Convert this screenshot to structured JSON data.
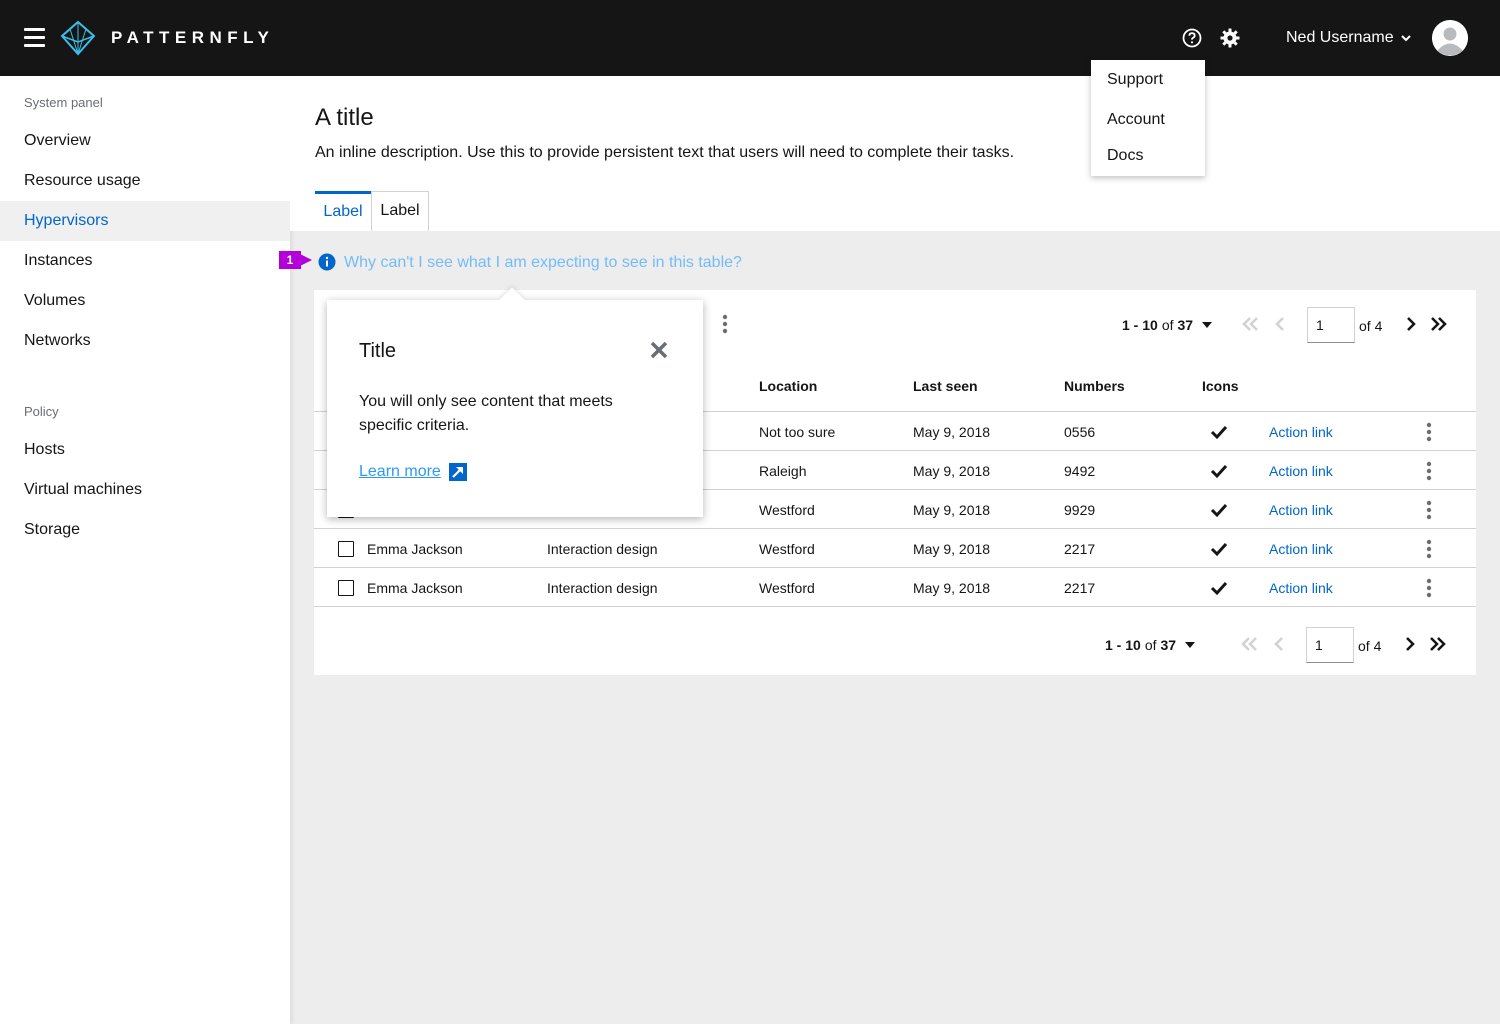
{
  "header": {
    "brand": "PATTERNFLY",
    "user_name": "Ned Username",
    "icons": [
      "hamburger-icon",
      "patternfly-logo-icon",
      "help-icon",
      "gear-icon",
      "chevron-down-icon",
      "avatar-icon"
    ]
  },
  "user_dropdown": {
    "items": [
      "Support",
      "Account",
      "Docs"
    ]
  },
  "sidebar": {
    "section_system": "System panel",
    "system_items": [
      "Overview",
      "Resource usage",
      "Hypervisors",
      "Instances",
      "Volumes",
      "Networks"
    ],
    "active_item": "Hypervisors",
    "section_policy": "Policy",
    "policy_items": [
      "Hosts",
      "Virtual machines",
      "Storage"
    ]
  },
  "page": {
    "title": "A title",
    "description": "An inline description. Use this to provide persistent text that users will need to complete their tasks.",
    "tabs": [
      "Label",
      "Label"
    ],
    "marker": "1",
    "help_link": "Why can't I see what I am expecting to see in this table?"
  },
  "popover": {
    "title": "Title",
    "body": "You will only see content that meets specific criteria.",
    "link": "Learn more"
  },
  "pagination": {
    "range_bold": "1 - 10",
    "of_text": "of",
    "total": "37",
    "page": "1",
    "of_pages": "of 4"
  },
  "table": {
    "columns": [
      "Location",
      "Last seen",
      "Numbers",
      "Icons"
    ],
    "rows": [
      {
        "name": "",
        "dept": "",
        "location": "Not too sure",
        "last_seen": "May 9, 2018",
        "number": "0556",
        "action": "Action link"
      },
      {
        "name": "",
        "dept": "",
        "location": "Raleigh",
        "last_seen": "May 9, 2018",
        "number": "9492",
        "action": "Action link"
      },
      {
        "name": "",
        "dept": "",
        "location": "Westford",
        "last_seen": "May 9, 2018",
        "number": "9929",
        "action": "Action link"
      },
      {
        "name": "Emma Jackson",
        "dept": "Interaction design",
        "location": "Westford",
        "last_seen": "May 9, 2018",
        "number": "2217",
        "action": "Action link"
      },
      {
        "name": "Emma Jackson",
        "dept": "Interaction design",
        "location": "Westford",
        "last_seen": "May 9, 2018",
        "number": "2217",
        "action": "Action link"
      }
    ]
  },
  "colors": {
    "masthead": "#151515",
    "link": "#0066cc",
    "help_link": "#73bcf7",
    "marker": "#b300d9"
  }
}
